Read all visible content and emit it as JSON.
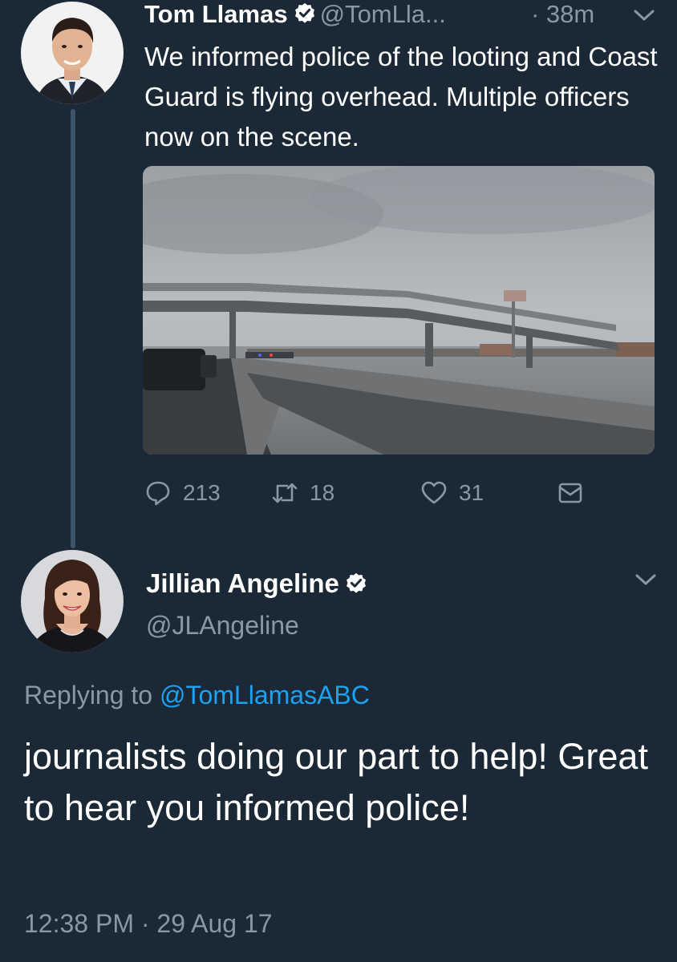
{
  "colors": {
    "background": "#1b2836",
    "secondary_text": "#8899a6",
    "link": "#1da1f2",
    "thread_line": "#3d5466"
  },
  "tweet1": {
    "name": "Tom Llamas",
    "handle": "@TomLla...",
    "time": "· 38m",
    "text": "We informed police of the looting and Coast Guard is flying overhead. Multiple officers now on the scene.",
    "actions": {
      "reply_count": "213",
      "retweet_count": "18",
      "like_count": "31"
    },
    "icons": [
      "verified-badge-icon",
      "chevron-down-icon",
      "reply-icon",
      "retweet-icon",
      "like-heart-icon",
      "direct-message-icon"
    ]
  },
  "tweet2": {
    "name": "Jillian Angeline",
    "handle": "@JLAngeline",
    "replying_prefix": "Replying to",
    "replying_to": "@TomLlamasABC",
    "text": "journalists doing our part to help! Great to hear you informed police!",
    "timestamp": "12:38 PM · 29 Aug 17"
  }
}
